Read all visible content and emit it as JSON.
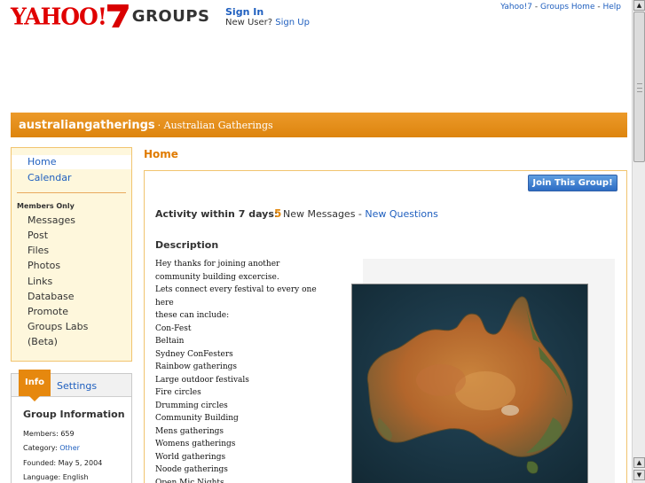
{
  "header": {
    "logo_yahoo": "YAHOO!",
    "logo_groups": "GROUPS",
    "sign_in": "Sign In",
    "new_user": "New User?",
    "sign_up": "Sign Up",
    "top_links": {
      "yahoo7": "Yahoo!7",
      "sep1": " - ",
      "groups_home": "Groups Home",
      "sep2": " - ",
      "help": "Help"
    }
  },
  "banner": {
    "group_id": "australiangatherings",
    "group_title": " · Australian Gatherings"
  },
  "nav": {
    "home": "Home",
    "calendar": "Calendar",
    "members_only": "Members Only",
    "items": [
      "Messages",
      "Post",
      "Files",
      "Photos",
      "Links",
      "Database",
      "Promote",
      "Groups Labs",
      "(Beta)"
    ]
  },
  "info": {
    "tab_info": "Info",
    "tab_settings": "Settings",
    "title": "Group Information",
    "members_label": "Members:",
    "members_value": "659",
    "category_label": "Category:",
    "category_value": "Other",
    "founded_label": "Founded:",
    "founded_value": "May 5, 2004",
    "language_label": "Language:",
    "language_value": "English"
  },
  "main": {
    "home_title": "Home",
    "join_button": "Join This Group!",
    "activity_label": "Activity within 7 days:",
    "activity_count": "5",
    "activity_text": "New Messages",
    "activity_sep": " - ",
    "activity_link": "New Questions",
    "description_heading": "Description",
    "description_lines": [
      "Hey thanks for joining another",
      "community building excercise.",
      "Lets connect every festival to every one",
      "here",
      "these can include:",
      "Con-Fest",
      "Beltain",
      "Sydney ConFesters",
      "Rainbow gatherings",
      "Large outdoor festivals",
      "Fire circles",
      "Drumming circles",
      "Community Building",
      "Mens gatherings",
      "Womens gatherings",
      "World gatherings",
      "Noode gatherings",
      "Open Mic Nights"
    ]
  },
  "colors": {
    "brand_orange": "#e38a12",
    "link_blue": "#1f5fbf",
    "nav_bg": "#fef7dc",
    "yahoo_red": "#e00000"
  }
}
